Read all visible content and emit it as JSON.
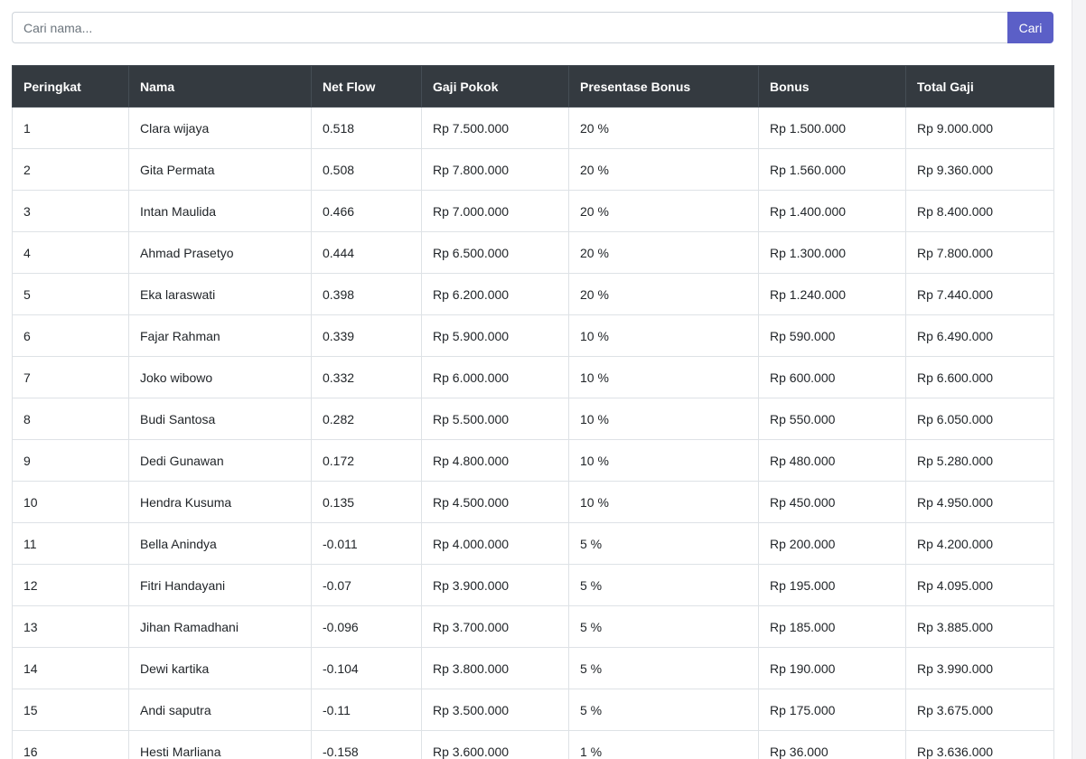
{
  "search": {
    "placeholder": "Cari nama...",
    "button_label": "Cari"
  },
  "table": {
    "columns": [
      "Peringkat",
      "Nama",
      "Net Flow",
      "Gaji Pokok",
      "Presentase Bonus",
      "Bonus",
      "Total Gaji"
    ],
    "rows": [
      [
        "1",
        "Clara wijaya",
        "0.518",
        "Rp 7.500.000",
        "20 %",
        "Rp 1.500.000",
        "Rp 9.000.000"
      ],
      [
        "2",
        "Gita Permata",
        "0.508",
        "Rp 7.800.000",
        "20 %",
        "Rp 1.560.000",
        "Rp 9.360.000"
      ],
      [
        "3",
        "Intan Maulida",
        "0.466",
        "Rp 7.000.000",
        "20 %",
        "Rp 1.400.000",
        "Rp 8.400.000"
      ],
      [
        "4",
        "Ahmad Prasetyo",
        "0.444",
        "Rp 6.500.000",
        "20 %",
        "Rp 1.300.000",
        "Rp 7.800.000"
      ],
      [
        "5",
        "Eka laraswati",
        "0.398",
        "Rp 6.200.000",
        "20 %",
        "Rp 1.240.000",
        "Rp 7.440.000"
      ],
      [
        "6",
        "Fajar Rahman",
        "0.339",
        "Rp 5.900.000",
        "10 %",
        "Rp 590.000",
        "Rp 6.490.000"
      ],
      [
        "7",
        "Joko wibowo",
        "0.332",
        "Rp 6.000.000",
        "10 %",
        "Rp 600.000",
        "Rp 6.600.000"
      ],
      [
        "8",
        "Budi Santosa",
        "0.282",
        "Rp 5.500.000",
        "10 %",
        "Rp 550.000",
        "Rp 6.050.000"
      ],
      [
        "9",
        "Dedi Gunawan",
        "0.172",
        "Rp 4.800.000",
        "10 %",
        "Rp 480.000",
        "Rp 5.280.000"
      ],
      [
        "10",
        "Hendra Kusuma",
        "0.135",
        "Rp 4.500.000",
        "10 %",
        "Rp 450.000",
        "Rp 4.950.000"
      ],
      [
        "11",
        "Bella Anindya",
        "-0.011",
        "Rp 4.000.000",
        "5 %",
        "Rp 200.000",
        "Rp 4.200.000"
      ],
      [
        "12",
        "Fitri Handayani",
        "-0.07",
        "Rp 3.900.000",
        "5 %",
        "Rp 195.000",
        "Rp 4.095.000"
      ],
      [
        "13",
        "Jihan Ramadhani",
        "-0.096",
        "Rp 3.700.000",
        "5 %",
        "Rp 185.000",
        "Rp 3.885.000"
      ],
      [
        "14",
        "Dewi kartika",
        "-0.104",
        "Rp 3.800.000",
        "5 %",
        "Rp 190.000",
        "Rp 3.990.000"
      ],
      [
        "15",
        "Andi saputra",
        "-0.11",
        "Rp 3.500.000",
        "5 %",
        "Rp 175.000",
        "Rp 3.675.000"
      ],
      [
        "16",
        "Hesti Marliana",
        "-0.158",
        "Rp 3.600.000",
        "1 %",
        "Rp 36.000",
        "Rp 3.636.000"
      ]
    ]
  }
}
